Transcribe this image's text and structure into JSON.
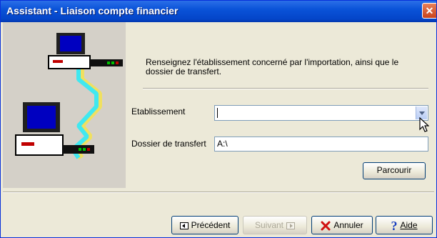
{
  "window": {
    "title": "Assistant - Liaison compte financier",
    "close_icon": "close-icon"
  },
  "illustration": {
    "icon": "network-computers-icon"
  },
  "intro": {
    "text": "Renseignez l'établissement concerné par l'importation, ainsi que le dossier de transfert."
  },
  "form": {
    "etablissement_label": "Etablissement",
    "etablissement_value": "",
    "dossier_label": "Dossier de transfert",
    "dossier_value": "A:\\"
  },
  "buttons": {
    "browse": "Parcourir",
    "previous": "Précédent",
    "next": "Suivant",
    "cancel": "Annuler",
    "help": "Aide"
  },
  "colors": {
    "title_bar": "#0a53d8",
    "dialog_bg": "#ece9d8",
    "disabled_text": "#aca899"
  }
}
